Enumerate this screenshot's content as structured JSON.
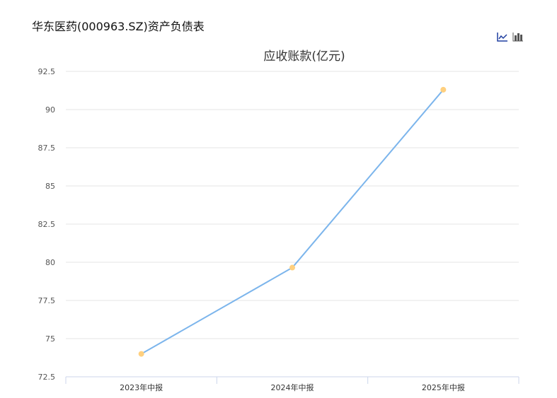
{
  "page_title": "华东医药(000963.SZ)资产负债表",
  "toolbar": {
    "line_icon": "line-chart-icon",
    "bar_icon": "bar-chart-icon"
  },
  "chart_data": {
    "type": "line",
    "title": "应收账款(亿元)",
    "categories": [
      "2023年中报",
      "2024年中报",
      "2025年中报"
    ],
    "series": [
      {
        "name": "应收账款",
        "values": [
          74.0,
          79.65,
          91.3
        ]
      }
    ],
    "ylim": [
      72.5,
      92.5
    ],
    "yticks": [
      "72.5",
      "75",
      "77.5",
      "80",
      "82.5",
      "85",
      "87.5",
      "90",
      "92.5"
    ],
    "grid": true,
    "colors": {
      "line": "#7cb5ec",
      "point": "#ffd07f",
      "grid": "#e6e6e6"
    }
  }
}
